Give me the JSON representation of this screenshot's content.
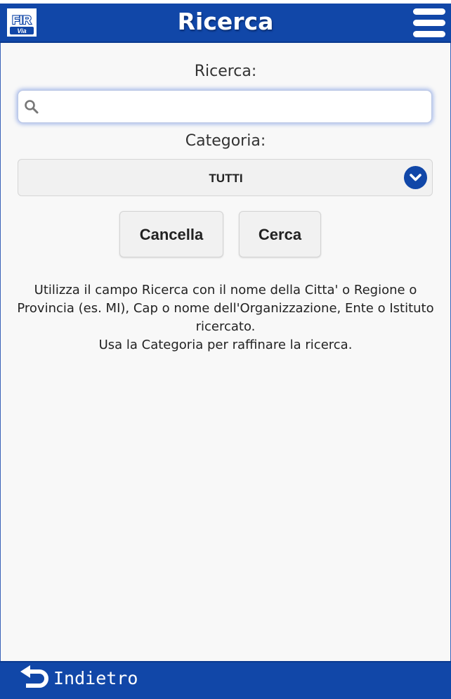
{
  "header": {
    "title": "Ricerca",
    "logo_text": "FIR Via",
    "menu_icon": "hamburger-menu-icon",
    "brand_color": "#1147a8"
  },
  "search": {
    "label": "Ricerca:",
    "value": "",
    "placeholder": "",
    "icon": "search-icon"
  },
  "category": {
    "label": "Categoria:",
    "selected": "TUTTI",
    "icon": "chevron-down-icon"
  },
  "buttons": {
    "cancel_label": "Cancella",
    "search_label": "Cerca"
  },
  "info": {
    "line1": "Utilizza il campo Ricerca con il nome della Citta' o Regione o Provincia (es. MI), Cap o nome dell'Organizzazione, Ente o Istituto ricercato.",
    "line2": "Usa la Categoria per raffinare la ricerca."
  },
  "footer": {
    "back_label": "Indietro",
    "back_icon": "back-arrow-icon"
  }
}
